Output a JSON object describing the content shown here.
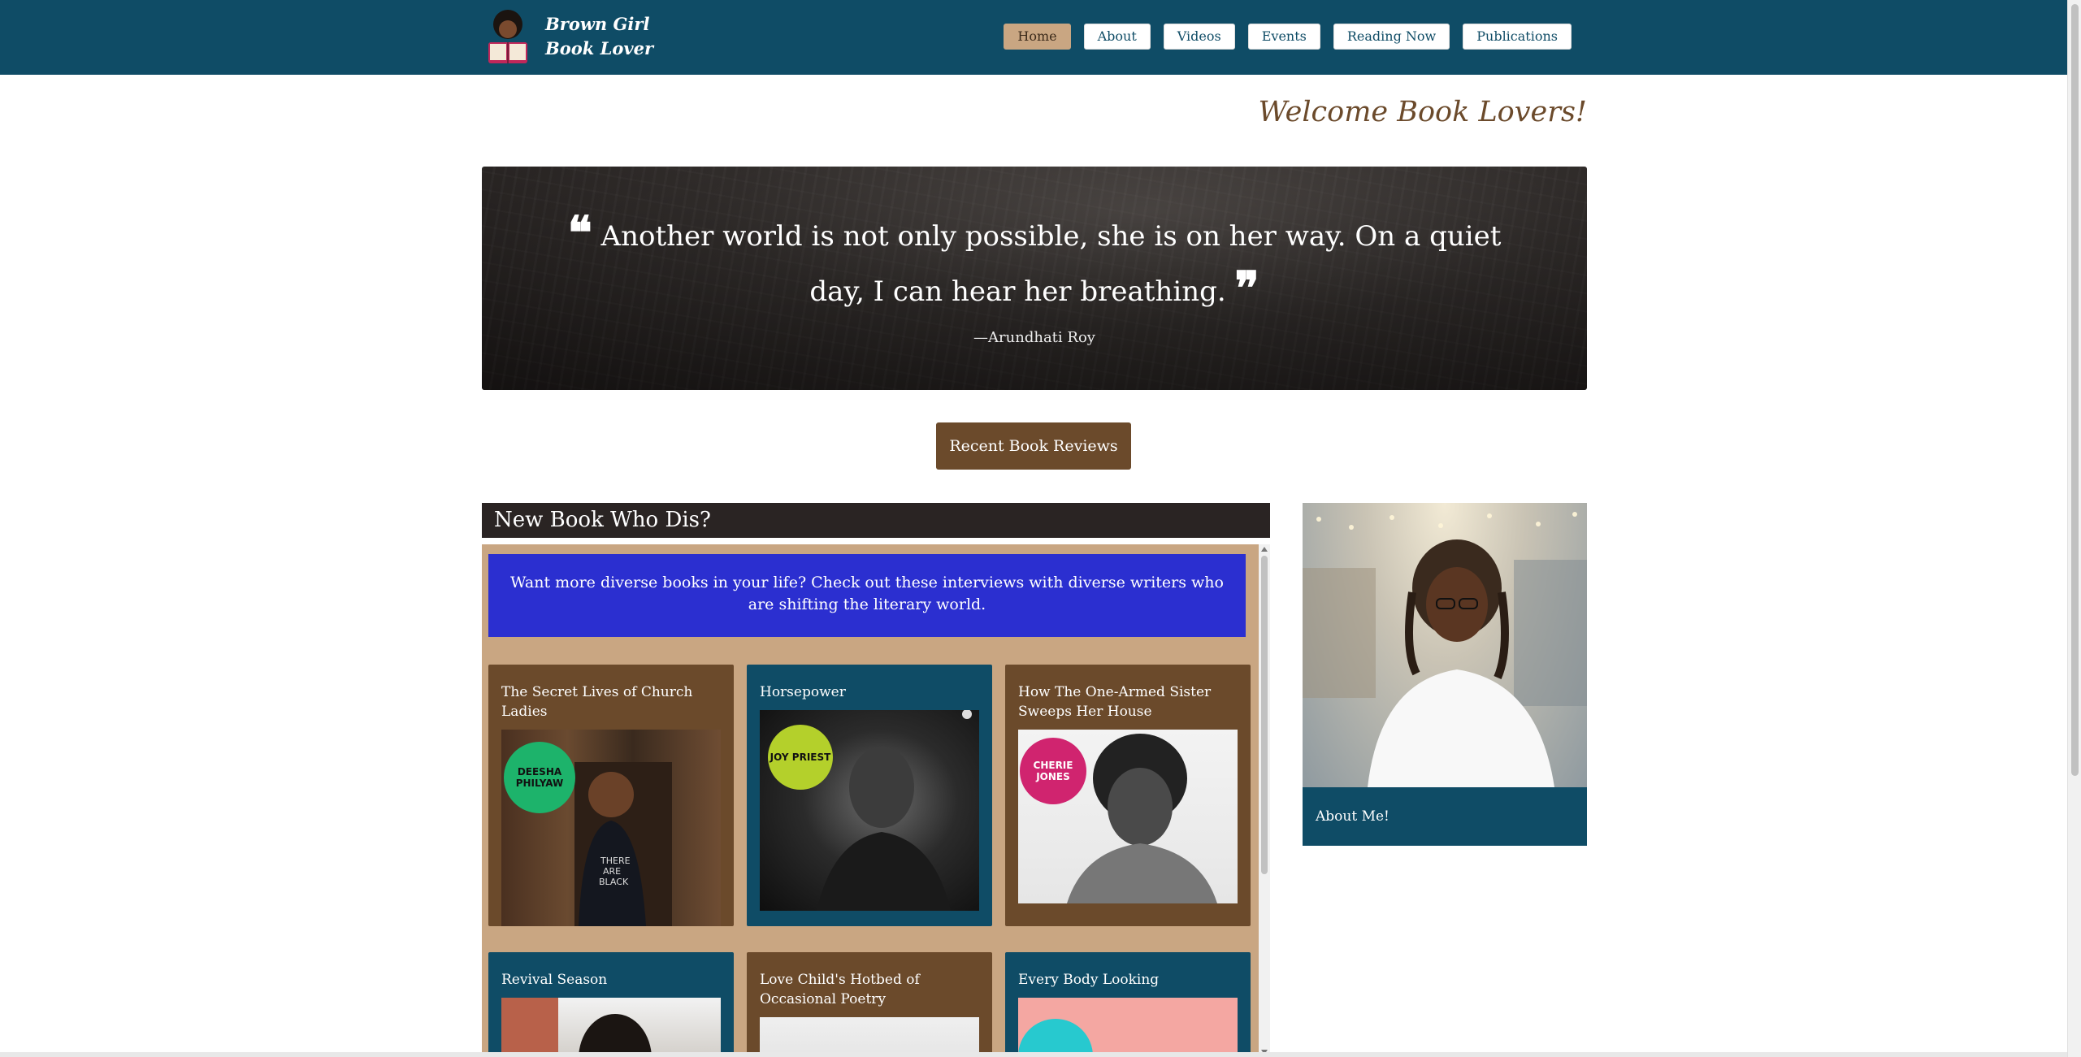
{
  "brand": {
    "line1": "Brown Girl",
    "line2": "Book Lover"
  },
  "nav": [
    "Home",
    "About",
    "Videos",
    "Events",
    "Reading Now",
    "Publications"
  ],
  "welcome": "Welcome Book Lovers!",
  "hero": {
    "quote": "Another world is not only possible, she is on her way. On a quiet day, I can hear her breathing.",
    "author": "—Arundhati Roy"
  },
  "reviews_button": "Recent Book Reviews",
  "section": {
    "title": "New Book Who Dis?",
    "banner": "Want more diverse books in your life? Check out these interviews with diverse writers who are shifting the literary world.",
    "cards": [
      {
        "title": "The Secret Lives of Church Ladies",
        "badge": "DEESHA PHILYAW",
        "badge_color": "#1db36b"
      },
      {
        "title": "Horsepower",
        "badge": "JOY PRIEST",
        "badge_color": "#b4d02b"
      },
      {
        "title": "How The One-Armed Sister Sweeps Her House",
        "badge": "CHERIE JONES",
        "badge_color": "#d0246f"
      },
      {
        "title": "Revival Season",
        "badge": "",
        "badge_color": ""
      },
      {
        "title": "Love Child's Hotbed of Occasional Poetry",
        "badge": "",
        "badge_color": ""
      },
      {
        "title": "Every Body Looking",
        "badge": "",
        "badge_color": "#27c9cf"
      }
    ]
  },
  "about": {
    "label": "About Me!"
  },
  "colors": {
    "nav_bg": "#0f4c66",
    "accent_brown": "#6b4a2b",
    "tan": "#c9a682",
    "banner_blue": "#2b2fd0"
  }
}
